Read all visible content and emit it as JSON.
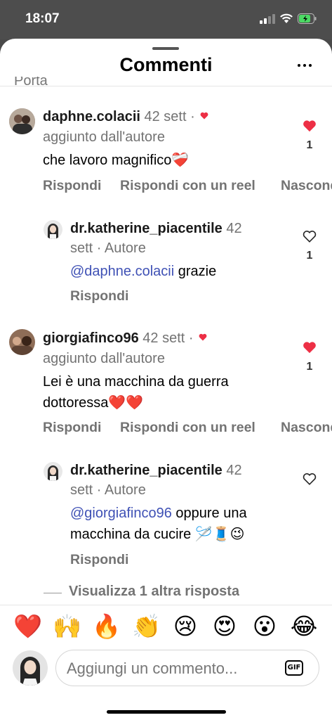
{
  "status_bar": {
    "time": "18:07"
  },
  "header": {
    "title": "Commenti",
    "cut_text": "Porta"
  },
  "comments": [
    {
      "username": "daphne.colacii",
      "time": "42 sett",
      "dot": "·",
      "added_by_author": "aggiunto dall'autore",
      "text": "che lavoro magnifico❤️‍🩹",
      "likes": "1",
      "liked": true,
      "actions": {
        "reply": "Rispondi",
        "reply_reel": "Rispondi con un reel",
        "hide": "Nascondi"
      },
      "reply": {
        "username": "dr.katherine_piacentile",
        "time_1": "42",
        "time_2": "sett · Autore",
        "mention": "@daphne.colacii",
        "text": " grazie",
        "likes": "1",
        "reply_label": "Rispondi"
      }
    },
    {
      "username": "giorgiafinco96",
      "time": "42 sett",
      "dot": "·",
      "added_by_author": "aggiunto dall'autore",
      "text_line1": "Lei è una macchina da guerra",
      "text_line2": "dottoressa❤️❤️",
      "likes": "1",
      "liked": true,
      "actions": {
        "reply": "Rispondi",
        "reply_reel": "Rispondi con un reel",
        "hide": "Nascondi"
      },
      "reply": {
        "username": "dr.katherine_piacentile",
        "time_1": "42",
        "time_2": "sett · Autore",
        "mention": "@giorgiafinco96",
        "text_line1": " oppure una",
        "text_line2": "macchina da cucire 🪡🧵😉",
        "reply_label": "Rispondi"
      }
    }
  ],
  "view_more": "Visualizza 1 altra risposta",
  "emojis": [
    "❤️",
    "🙌",
    "🔥",
    "👏",
    "😢",
    "😍",
    "😮",
    "😂"
  ],
  "composer": {
    "placeholder": "Aggiungi un commento...",
    "gif_label": "GIF"
  },
  "colors": {
    "like_red": "#ed2f45",
    "mention_blue": "#3f51b5",
    "meta_gray": "#737373"
  }
}
